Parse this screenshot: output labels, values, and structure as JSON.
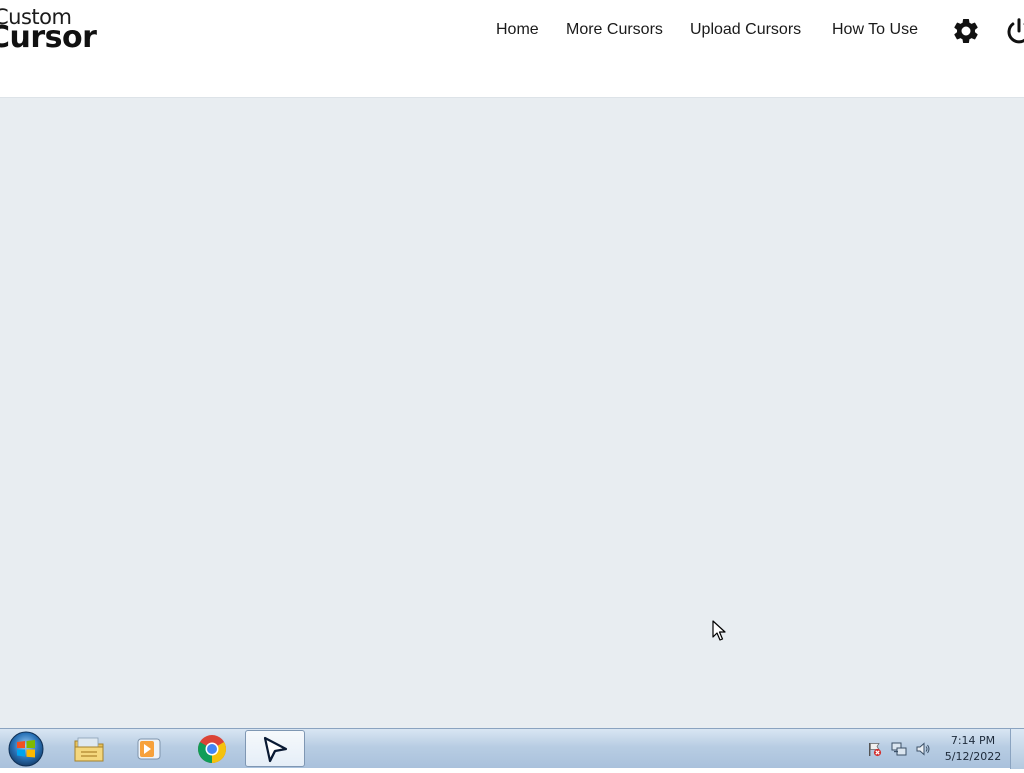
{
  "app": {
    "logo": {
      "line1": "Custom",
      "line2": "Cursor"
    },
    "nav": {
      "home": "Home",
      "more_cursors": "More Cursors",
      "upload_cursors": "Upload Cursors",
      "how_to_use": "How To Use"
    },
    "icons": {
      "settings": "gear-icon",
      "power": "power-icon"
    },
    "colors": {
      "header_bg": "#ffffff",
      "content_bg": "#e8edf1",
      "text": "#1a1a1a"
    }
  },
  "taskbar": {
    "start": "windows-start-orb",
    "pinned": [
      "file-explorer-icon",
      "media-player-icon",
      "chrome-icon",
      "custom-cursor-app-icon"
    ],
    "tray": [
      "action-center-flag-icon",
      "network-icon",
      "volume-icon"
    ],
    "clock": {
      "time": "7:14 PM",
      "date": "5/12/2022"
    }
  }
}
